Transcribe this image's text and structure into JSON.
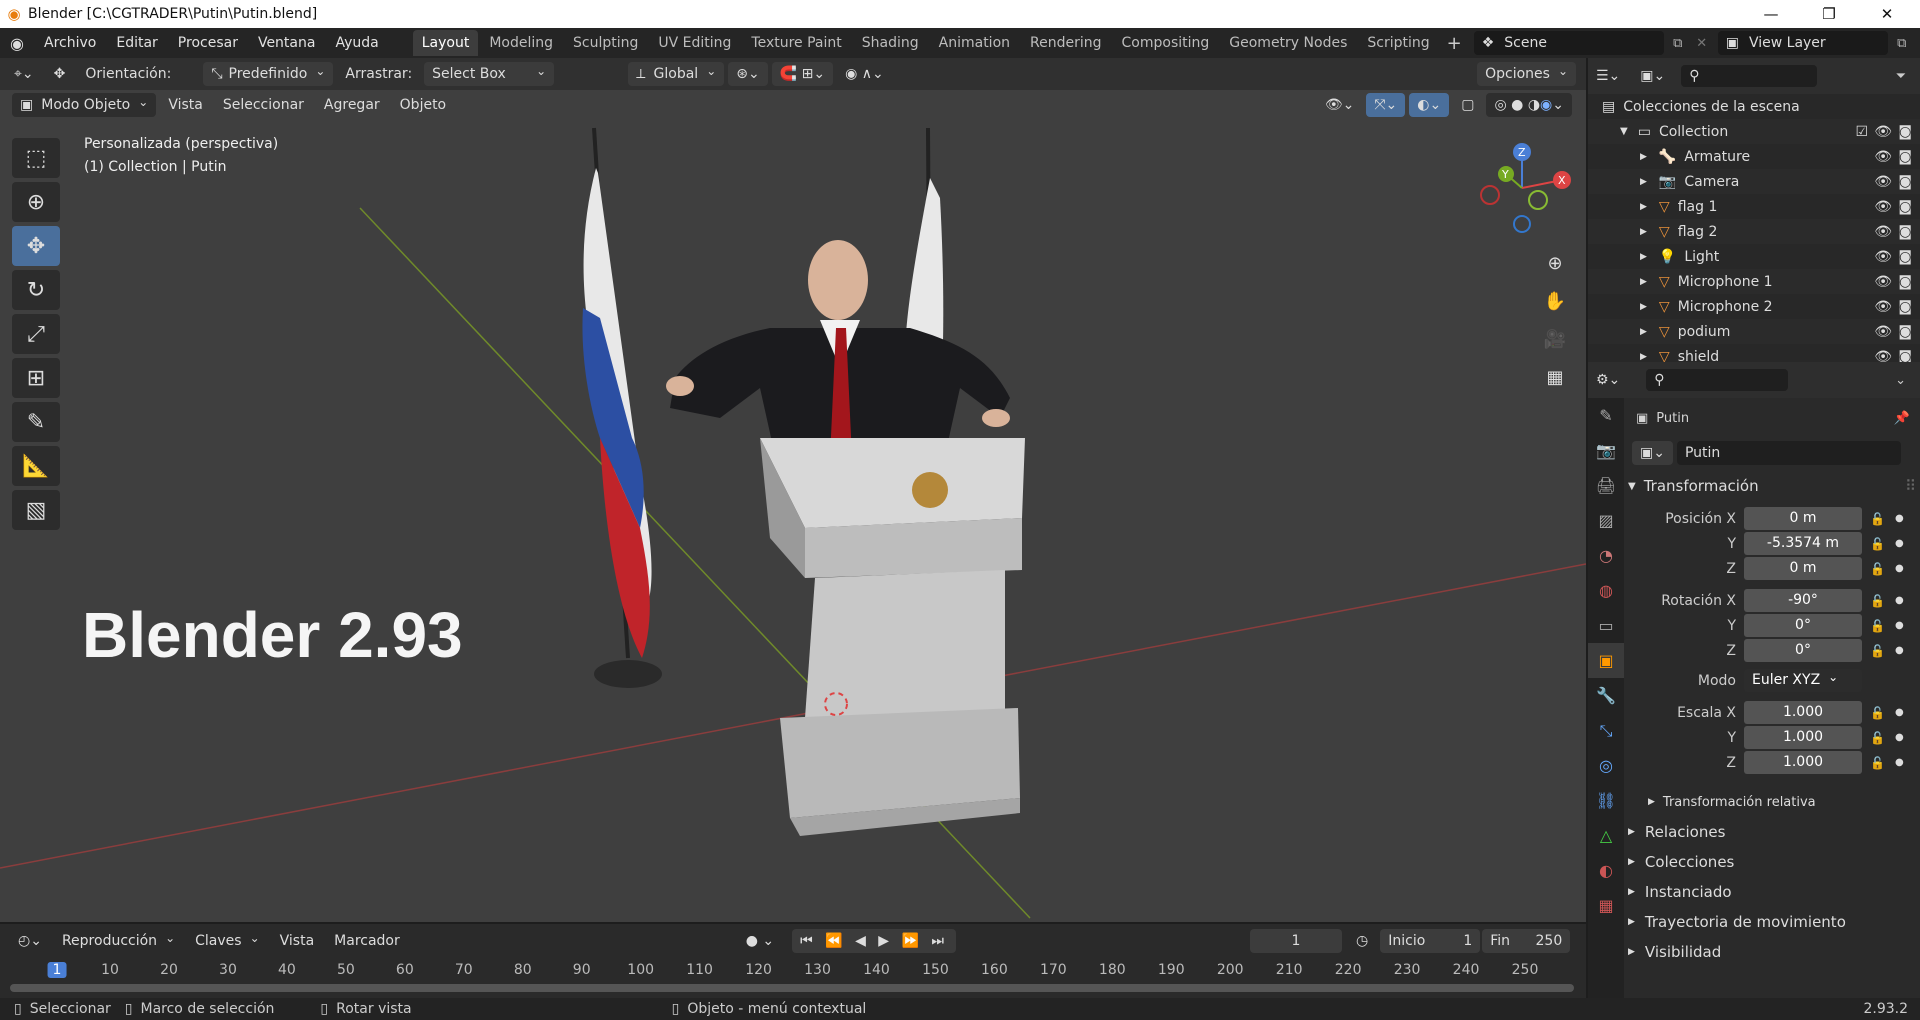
{
  "window": {
    "title": "Blender [C:\\CGTRADER\\Putin\\Putin.blend]",
    "minimize": "—",
    "maximize": "❐",
    "close": "✕"
  },
  "menu": [
    "Archivo",
    "Editar",
    "Procesar",
    "Ventana",
    "Ayuda"
  ],
  "workspaces": [
    "Layout",
    "Modeling",
    "Sculpting",
    "UV Editing",
    "Texture Paint",
    "Shading",
    "Animation",
    "Rendering",
    "Compositing",
    "Geometry Nodes",
    "Scripting"
  ],
  "active_workspace": "Layout",
  "scene": "Scene",
  "view_layer": "View Layer",
  "viewport": {
    "orientation_label": "Orientación:",
    "orientation_value": "Predefinido",
    "drag_label": "Arrastrar:",
    "drag_value": "Select Box",
    "transform_orientation": "Global",
    "options": "Opciones",
    "mode": "Modo Objeto",
    "menus": [
      "Vista",
      "Seleccionar",
      "Agregar",
      "Objeto"
    ],
    "overlay_line1": "Personalizada (perspectiva)",
    "overlay_line2": "(1) Collection | Putin",
    "big_text": "Blender 2.93",
    "gizmo": {
      "z": "Z",
      "y": "Y",
      "x": "X"
    }
  },
  "outliner": {
    "header": "Colecciones de la escena",
    "collection": "Collection",
    "items": [
      "Armature",
      "Camera",
      "flag 1",
      "flag 2",
      "Light",
      "Microphone 1",
      "Microphone 2",
      "podium",
      "shield"
    ]
  },
  "properties": {
    "object_name": "Putin",
    "data_name": "Putin",
    "section_transform": "Transformación",
    "position_label": "Posición X",
    "position": [
      "0 m",
      "-5.3574 m",
      "0 m"
    ],
    "rotation_label": "Rotación X",
    "rotation": [
      "-90°",
      "0°",
      "0°"
    ],
    "mode_label": "Modo",
    "mode_value": "Euler XYZ",
    "scale_label": "Escala X",
    "scale": [
      "1.000",
      "1.000",
      "1.000"
    ],
    "axis_y": "Y",
    "axis_z": "Z",
    "relative": "Transformación relativa",
    "panels": [
      "Relaciones",
      "Colecciones",
      "Instanciado",
      "Trayectoria de movimiento",
      "Visibilidad"
    ]
  },
  "timeline": {
    "menus": [
      "Reproducción",
      "Claves",
      "Vista",
      "Marcador"
    ],
    "current_frame": "1",
    "start_label": "Inicio",
    "start": "1",
    "end_label": "Fin",
    "end": "250",
    "ticks": [
      "1",
      "10",
      "20",
      "30",
      "40",
      "50",
      "60",
      "70",
      "80",
      "90",
      "100",
      "110",
      "120",
      "130",
      "140",
      "150",
      "160",
      "170",
      "180",
      "190",
      "200",
      "210",
      "220",
      "230",
      "240",
      "250"
    ]
  },
  "status": {
    "select": "Seleccionar",
    "box": "Marco de selección",
    "rotate": "Rotar vista",
    "context": "Objeto - menú contextual",
    "version": "2.93.2"
  }
}
